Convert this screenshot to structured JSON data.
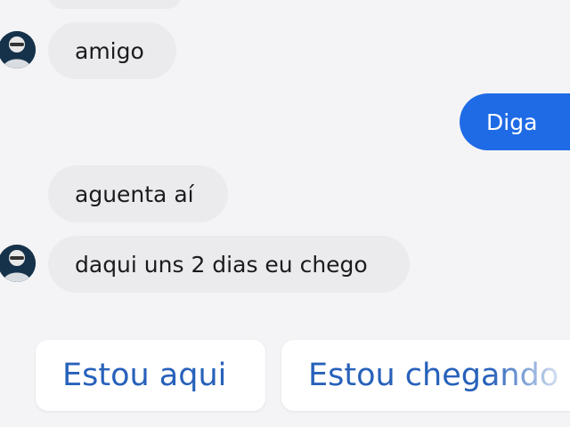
{
  "messages": [
    {
      "direction": "incoming",
      "text": "amigo"
    },
    {
      "direction": "outgoing",
      "text": "Diga"
    },
    {
      "direction": "incoming",
      "text": "aguenta aí"
    },
    {
      "direction": "incoming",
      "text": "daqui uns 2 dias eu chego"
    }
  ],
  "quick_replies": [
    "Estou aqui",
    "Estou chegando"
  ],
  "colors": {
    "background": "#f4f4f6",
    "incoming_bubble": "#ebebed",
    "outgoing_bubble": "#1f6be6",
    "quick_reply_text": "#2761ba"
  }
}
